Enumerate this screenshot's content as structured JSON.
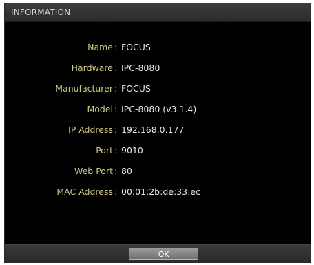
{
  "dialog": {
    "title": "INFORMATION",
    "separator": ":",
    "fields": [
      {
        "label": "Name",
        "value": "FOCUS"
      },
      {
        "label": "Hardware",
        "value": "IPC-8080"
      },
      {
        "label": "Manufacturer",
        "value": "FOCUS"
      },
      {
        "label": "Model",
        "value": "IPC-8080 (v3.1.4)"
      },
      {
        "label": "IP Address",
        "value": "192.168.0.177"
      },
      {
        "label": "Port",
        "value": "9010"
      },
      {
        "label": "Web Port",
        "value": "80"
      },
      {
        "label": "MAC Address",
        "value": "00:01:2b:de:33:ec"
      }
    ],
    "ok_label": "OK"
  },
  "colors": {
    "background": "#000000",
    "label": "#cfc78a",
    "value": "#e6e6e6",
    "titlebar": "#2b2b2b",
    "button": "#8a8a8a"
  }
}
